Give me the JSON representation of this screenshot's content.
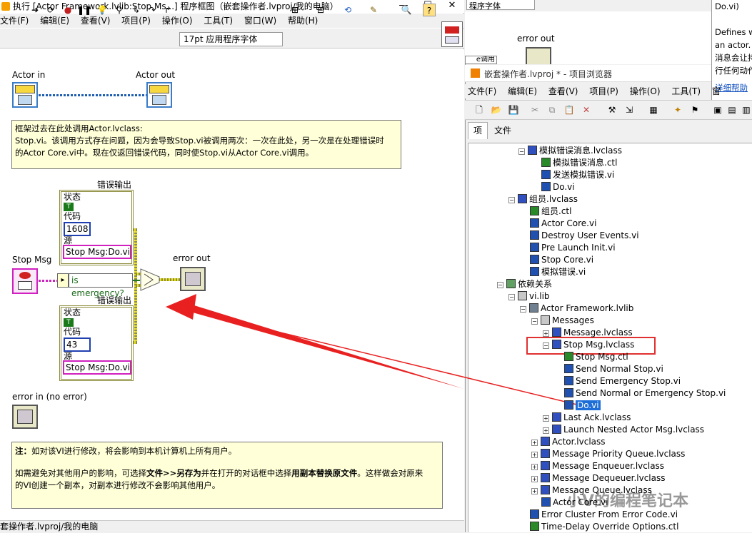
{
  "left_window": {
    "title": "执行 [Actor Framework.lvlib:Stop Ms...] 程序框图（嵌套操作者.lvproj/我的电脑）",
    "menu": [
      "文件(F)",
      "编辑(E)",
      "查看(V)",
      "项目(P)",
      "操作(O)",
      "工具(T)",
      "窗口(W)",
      "帮助(H)"
    ],
    "font_select": "17pt 应用程序字体",
    "status_bar": "套操作者.lvproj/我的电脑"
  },
  "diagram": {
    "actor_in": "Actor in",
    "actor_out": "Actor out",
    "comment_lines": [
      "框架过去在此处调用Actor.lvclass:",
      "Stop.vi。该调用方式存在问题，因为会导致Stop.vi被调用两次：一次在此处，另一次是在处理错误时",
      "的Actor Core.vi中。现在仅返回错误代码，同时使Stop.vi从Actor Core.vi调用。"
    ],
    "cluster1": {
      "caption": "错误输出",
      "status_label": "状态",
      "status_val": "T",
      "code_label": "代码",
      "code_val": "1608",
      "source_label": "源",
      "source_val": "Stop Msg:Do.vi"
    },
    "cluster2": {
      "caption": "错误输出",
      "status_label": "状态",
      "status_val": "T",
      "code_label": "代码",
      "code_val": "43",
      "source_label": "源",
      "source_val": "Stop Msg:Do.vi"
    },
    "stop_msg": "Stop Msg",
    "is_emergency": "is emergency?",
    "error_out": "error out",
    "error_in": "error in (no error)",
    "note": {
      "l1a": "注：",
      "l1b": "如对该VI进行修改，将会影响到本机计算机上所有用户。",
      "l2a": "如需避免对其他用户的影响，可选择",
      "l2b": "文件>>另存为",
      "l2c": "并在打开的对话框中选择",
      "l2d": "用副本替换原文件",
      "l2e": "。这样做会对原来",
      "l3": "的VI创建一个副本，对副本进行修改不会影响其他用户。"
    }
  },
  "back_window": {
    "font_select": "程序字体",
    "error_out": "error out",
    "partial_label": "e调用"
  },
  "project": {
    "title": "嵌套操作者.lvproj * - 项目浏览器",
    "menu": [
      "文件(F)",
      "编辑(E)",
      "查看(V)",
      "项目(P)",
      "操作(O)",
      "工具(T)",
      "窗"
    ],
    "tabs": [
      "项",
      "文件"
    ],
    "tree": [
      {
        "label": "模拟错误消息.lvclass",
        "icon": "class"
      },
      {
        "label": "模拟错误消息.ctl",
        "icon": "ctl"
      },
      {
        "label": "发送模拟错误.vi",
        "icon": "vi"
      },
      {
        "label": "Do.vi",
        "icon": "vi"
      },
      {
        "label": "组员.lvclass",
        "icon": "class"
      },
      {
        "label": "组员.ctl",
        "icon": "ctl"
      },
      {
        "label": "Actor Core.vi",
        "icon": "vi"
      },
      {
        "label": "Destroy User Events.vi",
        "icon": "vi"
      },
      {
        "label": "Pre Launch Init.vi",
        "icon": "vi"
      },
      {
        "label": "Stop Core.vi",
        "icon": "vi"
      },
      {
        "label": "模拟错误.vi",
        "icon": "vi"
      },
      {
        "label": "依赖关系",
        "icon": "dep"
      },
      {
        "label": "vi.lib",
        "icon": "folder"
      },
      {
        "label": "Actor Framework.lvlib",
        "icon": "lib"
      },
      {
        "label": "Messages",
        "icon": "folder"
      },
      {
        "label": "Message.lvclass",
        "icon": "class"
      },
      {
        "label": "Stop Msg.lvclass",
        "icon": "class"
      },
      {
        "label": "Stop Msg.ctl",
        "icon": "ctl"
      },
      {
        "label": "Send Normal Stop.vi",
        "icon": "vi"
      },
      {
        "label": "Send Emergency Stop.vi",
        "icon": "vi"
      },
      {
        "label": "Send Normal or Emergency Stop.vi",
        "icon": "vi"
      },
      {
        "label": "Do.vi",
        "icon": "vi"
      },
      {
        "label": "Last Ack.lvclass",
        "icon": "class"
      },
      {
        "label": "Launch Nested Actor Msg.lvclass",
        "icon": "class"
      },
      {
        "label": "Actor.lvclass",
        "icon": "class"
      },
      {
        "label": "Message Priority Queue.lvclass",
        "icon": "class"
      },
      {
        "label": "Message Enqueuer.lvclass",
        "icon": "class"
      },
      {
        "label": "Message Dequeuer.lvclass",
        "icon": "class"
      },
      {
        "label": "Message Queue.lvclass",
        "icon": "class"
      },
      {
        "label": "Actor Core.vi",
        "icon": "vi"
      },
      {
        "label": "Error Cluster From Error Code.vi",
        "icon": "vi"
      },
      {
        "label": "Time-Delay Override Options.ctl",
        "icon": "ctl"
      }
    ]
  },
  "help": {
    "l1": "Do.vi)",
    "l2": "Defines w",
    "l3": "an actor.",
    "l4": "消息会让持",
    "l5": "行任何动作",
    "link": "详细帮助"
  },
  "watermark": "小V的编程笔记本",
  "colors": {
    "highlight_box": "#e03030",
    "arrow": "#e82020",
    "selected": "#1e6ed8"
  }
}
